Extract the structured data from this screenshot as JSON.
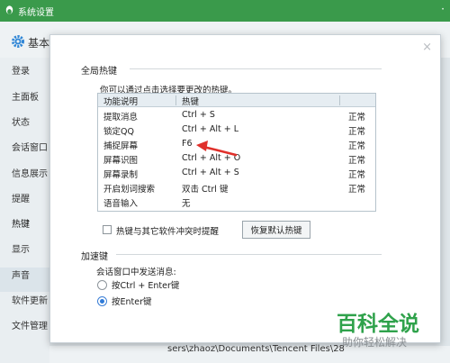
{
  "window": {
    "title": "系统设置",
    "header_label": "基本"
  },
  "sidebar": {
    "items": [
      {
        "label": "登录"
      },
      {
        "label": "主面板"
      },
      {
        "label": "状态"
      },
      {
        "label": "会话窗口"
      },
      {
        "label": "信息展示"
      },
      {
        "label": "提醒"
      },
      {
        "label": "热键"
      },
      {
        "label": "显示"
      },
      {
        "label": "声音"
      },
      {
        "label": "软件更新"
      },
      {
        "label": "文件管理"
      }
    ]
  },
  "background": {
    "path_text": "sers\\zhaoz\\Documents\\Tencent Files\\28"
  },
  "dialog": {
    "close_glyph": "×",
    "global_hotkeys": {
      "title": "全局热键",
      "hint": "你可以通过点击选择要更改的热键。",
      "table": {
        "headers": [
          "功能说明",
          "热键"
        ],
        "rows": [
          {
            "name": "提取消息",
            "key": "Ctrl + S",
            "status": "正常"
          },
          {
            "name": "锁定QQ",
            "key": "Ctrl + Alt + L",
            "status": "正常"
          },
          {
            "name": "捕捉屏幕",
            "key": "F6",
            "status": "正常"
          },
          {
            "name": "屏幕识图",
            "key": "Ctrl + Alt + O",
            "status": "正常"
          },
          {
            "name": "屏幕录制",
            "key": "Ctrl + Alt + S",
            "status": "正常"
          },
          {
            "name": "开启划词搜索",
            "key": "双击 Ctrl 键",
            "status": "正常"
          },
          {
            "name": "语音输入",
            "key": "无",
            "status": ""
          }
        ]
      },
      "conflict_checkbox_label": "热键与其它软件冲突时提醒",
      "conflict_checked": false,
      "restore_button": "恢复默认热键"
    },
    "accelerators": {
      "title": "加速键",
      "send_label": "会话窗口中发送消息:",
      "options": [
        {
          "label": "按Ctrl + Enter键",
          "checked": false
        },
        {
          "label": "按Enter键",
          "checked": true
        }
      ]
    }
  },
  "watermark": {
    "logo": "百科全说",
    "sub": "助你轻松解决"
  },
  "colors": {
    "titlebar": "#3a9a4b",
    "annotation_arrow": "#e0302b",
    "radio_accent": "#2f7bd8"
  }
}
